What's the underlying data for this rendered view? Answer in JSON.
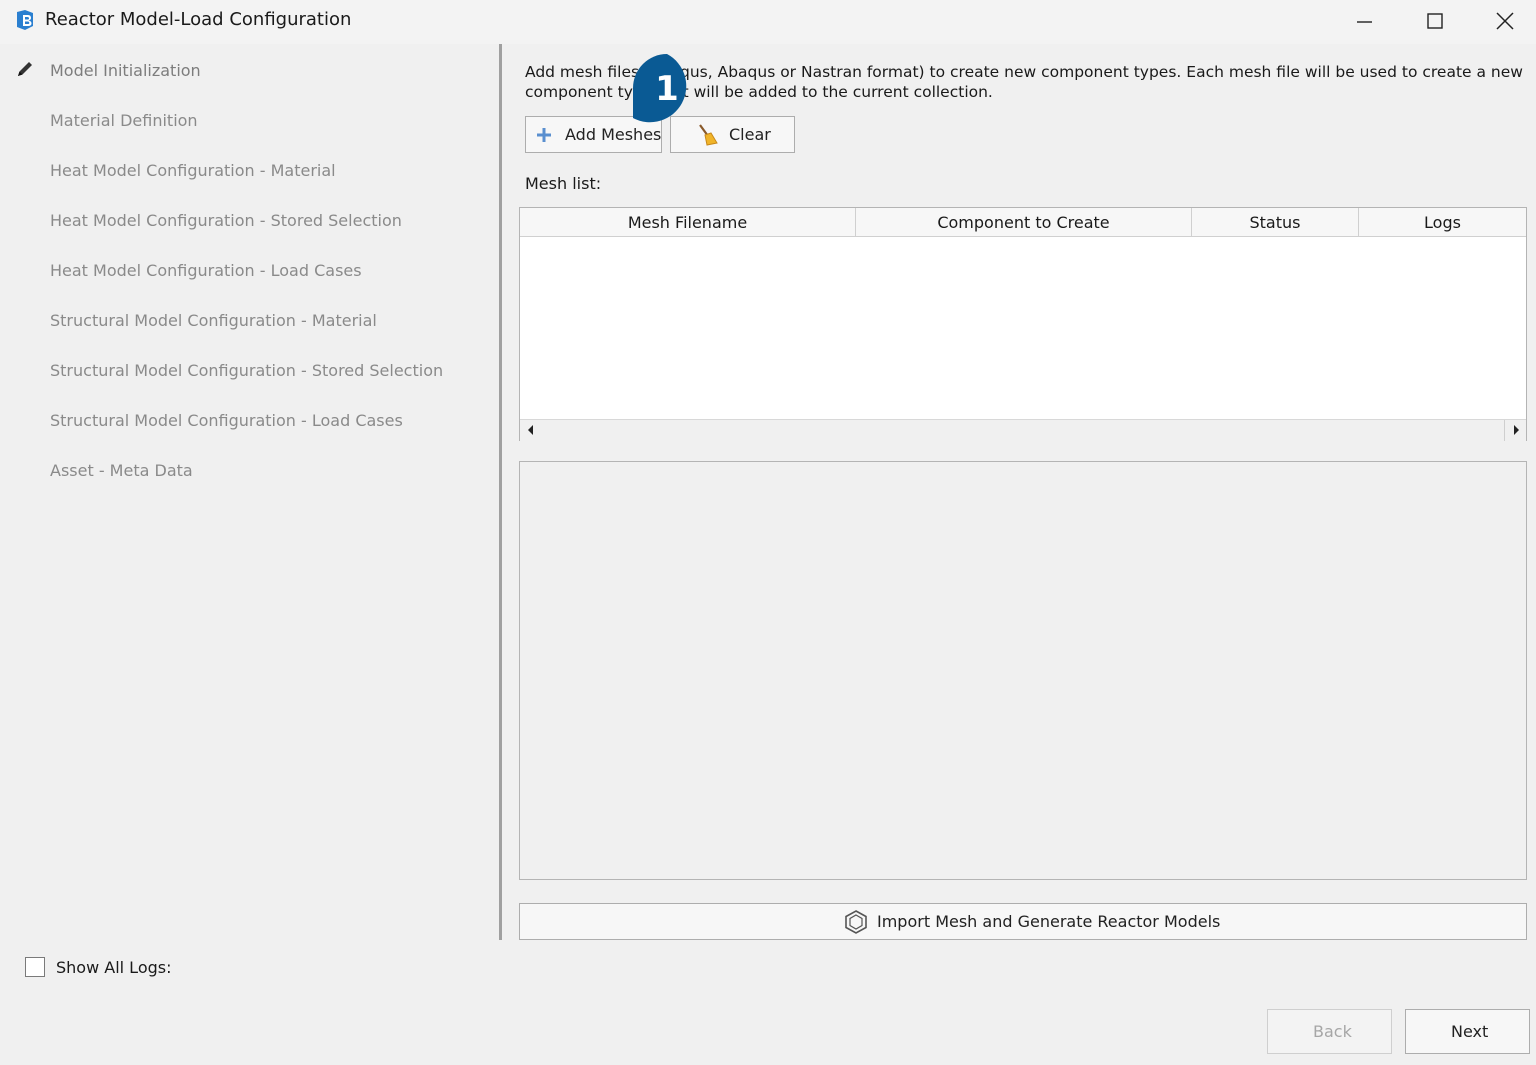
{
  "window": {
    "title": "Reactor Model-Load Configuration",
    "controls": [
      "minimize-icon",
      "maximize-icon",
      "close-icon"
    ]
  },
  "sidebar": {
    "steps": [
      {
        "label": "Model Initialization",
        "active": true
      },
      {
        "label": "Material Definition"
      },
      {
        "label": "Heat Model Configuration - Material"
      },
      {
        "label": "Heat Model Configuration - Stored Selection"
      },
      {
        "label": "Heat Model Configuration - Load Cases"
      },
      {
        "label": "Structural Model Configuration - Material"
      },
      {
        "label": "Structural Model Configuration - Stored Selection"
      },
      {
        "label": "Structural Model Configuration - Load Cases"
      },
      {
        "label": "Asset - Meta Data"
      }
    ]
  },
  "main": {
    "description_line1": "Add mesh files (Abaqus, Abaqus or Nastran format) to create new component types. Each mesh file will be used to create a new",
    "description_line2": "component type that will be added to the current collection.",
    "add_meshes_label": "Add Meshes",
    "clear_label": "Clear",
    "mesh_list_label": "Mesh list:",
    "table": {
      "columns": [
        "Mesh Filename",
        "Component to Create",
        "Status",
        "Logs"
      ],
      "rows": []
    },
    "import_button_label": "Import Mesh and Generate Reactor Models"
  },
  "callout": {
    "number": "1",
    "color": "#0a5a94"
  },
  "footer": {
    "show_all_logs_label": "Show All Logs:",
    "show_all_logs_checked": false,
    "back_label": "Back",
    "back_enabled": false,
    "next_label": "Next"
  },
  "colors": {
    "accent": "#1a6fb5",
    "background": "#f0f0f0",
    "disabled_text": "#a6a6a6"
  }
}
